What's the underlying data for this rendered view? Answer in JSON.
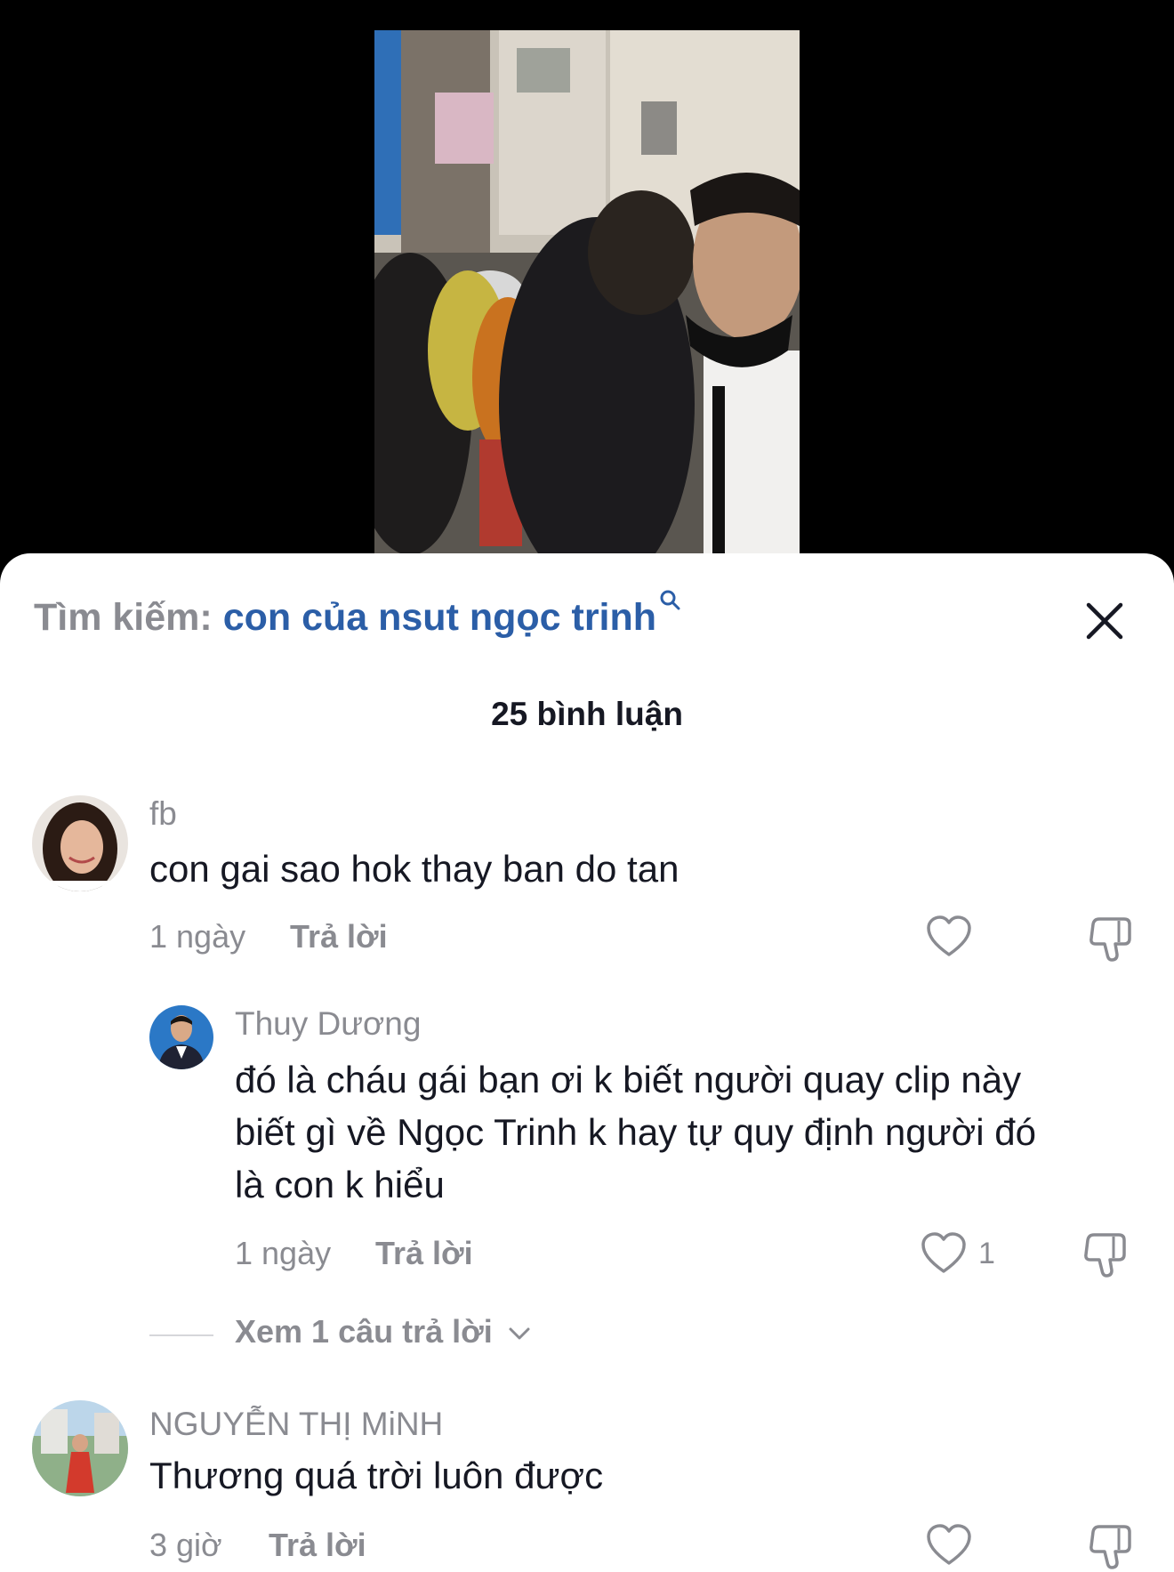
{
  "search": {
    "prefix": "Tìm kiếm:",
    "query": "con của nsut ngọc trinh"
  },
  "comments_header": {
    "count_label": "25 bình luận"
  },
  "comments": [
    {
      "user": "fb",
      "text": "con gai sao hok thay ban do tan",
      "time": "1 ngày",
      "reply_label": "Trả lời"
    },
    {
      "user": "Thuy Dương",
      "text_lines": [
        "đó là cháu gái bạn ơi k biết người quay clip này",
        "biết gì về Ngọc Trinh k hay tự quy định người đó",
        "là con k hiểu"
      ],
      "time": "1 ngày",
      "reply_label": "Trả lời",
      "likes": "1"
    },
    {
      "user": "NGUYỄN THỊ MiNH",
      "text": "Thương quá trời luôn được",
      "time": "3 giờ",
      "reply_label": "Trả lời"
    }
  ],
  "view_replies": {
    "label": "Xem 1 câu trả lời"
  },
  "icons": {
    "search": "search-icon",
    "close": "close-icon",
    "like": "heart-icon",
    "dislike": "thumbs-down-icon",
    "expand": "chevron-down-icon"
  },
  "colors": {
    "query": "#2b5ea7",
    "muted": "#8a8b91",
    "text": "#161823"
  }
}
